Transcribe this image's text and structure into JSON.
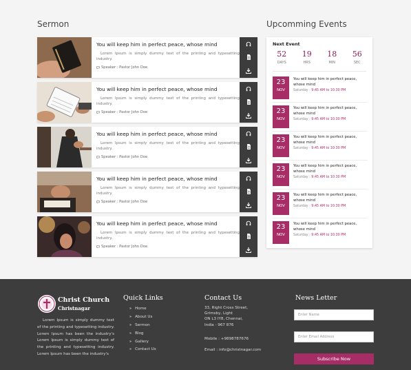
{
  "sermon": {
    "heading": "Sermon",
    "items": [
      {
        "title": "You will keep him in perfect peace, whose mind",
        "text": "Lorem Ipsum is simply dummy text of the printing and typesetting industry.",
        "speaker": "Speaker : Pastor John Doe",
        "photo": "bible-in-hand"
      },
      {
        "title": "You will keep him in perfect peace, whose mind",
        "text": "Lorem Ipsum is simply dummy text of the printing and typesetting industry.",
        "speaker": "Speaker : Pastor John Doe",
        "photo": "reading-bible"
      },
      {
        "title": "You will keep him in perfect peace, whose mind",
        "text": "Lorem Ipsum is simply dummy text of the printing and typesetting industry.",
        "speaker": "Speaker : Pastor John Doe",
        "photo": "kneeling-prayer"
      },
      {
        "title": "You will keep him in perfect peace, whose mind",
        "text": "Lorem Ipsum is simply dummy text of the printing and typesetting industry.",
        "speaker": "Speaker : Pastor John Doe",
        "photo": "praying-hands"
      },
      {
        "title": "You will keep him in perfect peace, whose mind",
        "text": "Lorem Ipsum is simply dummy text of the printing and typesetting industry.",
        "speaker": "Speaker : Pastor John Doe",
        "photo": "woman-praying"
      }
    ],
    "action_icons": [
      "headphones-icon",
      "document-icon",
      "download-icon"
    ]
  },
  "events": {
    "heading": "Upcomming Events",
    "next_label": "Next Event",
    "countdown": [
      {
        "value": "52",
        "label": "DAYS"
      },
      {
        "value": "19",
        "label": "HRS"
      },
      {
        "value": "18",
        "label": "MIN"
      },
      {
        "value": "56",
        "label": "SEC"
      }
    ],
    "items": [
      {
        "day": "23",
        "month": "NOV",
        "title": "You will keep him in perfect peace, whose mind",
        "prefix": "Saturday : ",
        "time": "9:45 AM to 10:30 PM"
      },
      {
        "day": "23",
        "month": "NOV",
        "title": "You will keep him in perfect peace, whose mind",
        "prefix": "Saturday : ",
        "time": "9:45 AM to 10:30 PM"
      },
      {
        "day": "23",
        "month": "NOV",
        "title": "You will keep him in perfect peace, whose mind",
        "prefix": "Saturday : ",
        "time": "9:45 AM to 10:30 PM"
      },
      {
        "day": "23",
        "month": "NOV",
        "title": "You will keep him in perfect peace, whose mind",
        "prefix": "Saturday : ",
        "time": "9:45 AM to 10:30 PM"
      },
      {
        "day": "23",
        "month": "NOV",
        "title": "You will keep him in perfect peace, whose mind",
        "prefix": "Saturday : ",
        "time": "9:45 AM to 10:30 PM"
      },
      {
        "day": "23",
        "month": "NOV",
        "title": "You will keep him in perfect peace, whose mind",
        "prefix": "Saturday : ",
        "time": "9:45 AM to 10:30 PM"
      }
    ]
  },
  "footer": {
    "brand_name": "Christ Church",
    "brand_sub": "Christnagar",
    "about": "Lorem Ipsum is simply dummy text of the printing and typesetting industry. Lorem Ipsum has been the industry's Lorem Ipsum is simply dummy text of the printing and typesetting industry. Lorem Ipsum has been the industry's",
    "quick_links_title": "Quick Links",
    "quick_links": [
      "Home",
      "About Us",
      "Sermon",
      "Blog",
      "Gallery",
      "Contact Us"
    ],
    "contact_title": "Contact Us",
    "address": [
      "33, Right Cross Street,",
      "Grimsby, Light",
      "ON L3 IY8, Chennai,",
      "India - 967 876"
    ],
    "mobile": "Mobile : +9898787676",
    "email": "Email : info@christnagar.com",
    "newsletter_title": "News Letter",
    "name_placeholder": "Enter Name",
    "email_placeholder": "Enter Email Address",
    "subscribe_label": "Subscribe Now"
  },
  "colors": {
    "accent": "#a72d67",
    "dark": "#3d3d3d",
    "countdown": "#8c1c56"
  }
}
